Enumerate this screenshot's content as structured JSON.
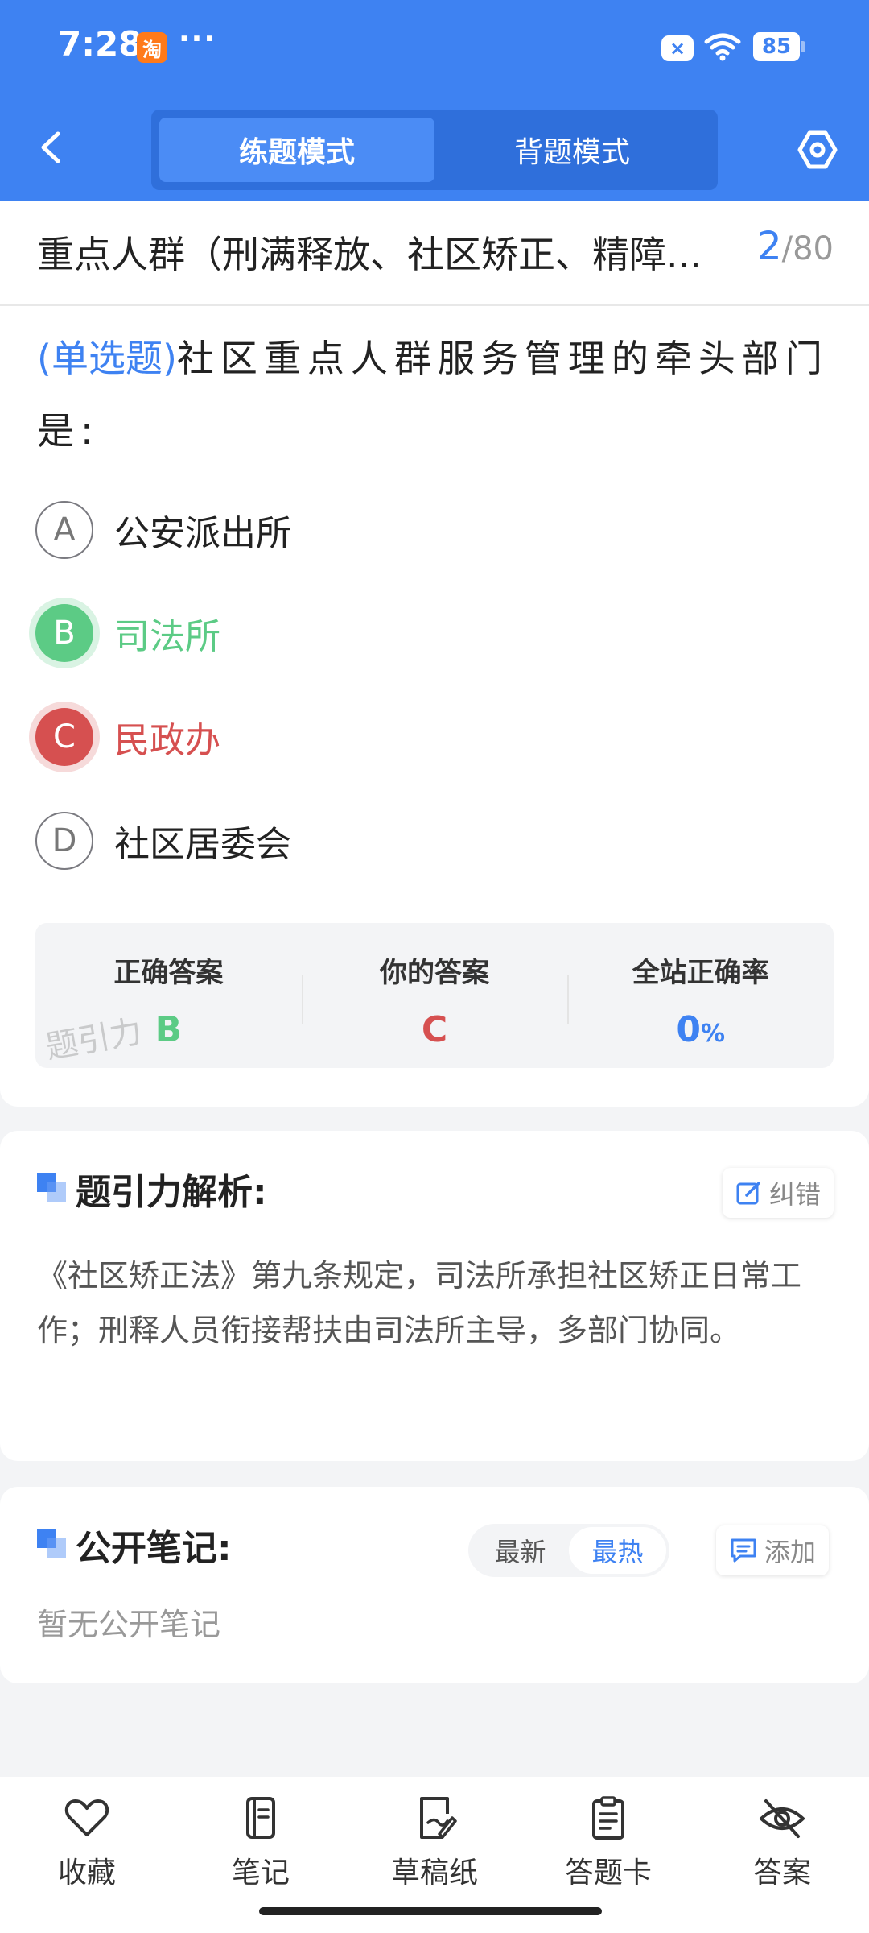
{
  "status_bar": {
    "time": "7:28",
    "app_badge": "淘",
    "dots": "···",
    "x_badge": "×",
    "battery": "85"
  },
  "app_bar": {
    "mode_tabs": [
      {
        "label": "练题模式",
        "active": true
      },
      {
        "label": "背题模式",
        "active": false
      }
    ]
  },
  "question": {
    "title": "重点人群（刑满释放、社区矫正、精障...",
    "current": "2",
    "total": "80",
    "type_tag": "(单选题)",
    "stem": "社区重点人群服务管理的牵头部门是:",
    "options": [
      {
        "letter": "A",
        "text": "公安派出所",
        "state": "normal"
      },
      {
        "letter": "B",
        "text": "司法所",
        "state": "correct"
      },
      {
        "letter": "C",
        "text": "民政办",
        "state": "wrong"
      },
      {
        "letter": "D",
        "text": "社区居委会",
        "state": "normal"
      }
    ]
  },
  "stats": {
    "correct_label": "正确答案",
    "correct_value": "B",
    "yours_label": "你的答案",
    "yours_value": "C",
    "rate_label": "全站正确率",
    "rate_value": "0",
    "rate_unit": "%",
    "watermark": "题引力"
  },
  "analysis": {
    "title": "题引力解析:",
    "report_label": "纠错",
    "text": "《社区矫正法》第九条规定，司法所承担社区矫正日常工作；刑释人员衔接帮扶由司法所主导，多部门协同。"
  },
  "notes": {
    "title": "公开笔记:",
    "sort_options": [
      "最新",
      "最热"
    ],
    "sort_active": "最热",
    "add_label": "添加",
    "empty_text": "暂无公开笔记"
  },
  "bottom_nav": [
    {
      "label": "收藏",
      "icon": "heart-icon"
    },
    {
      "label": "笔记",
      "icon": "notebook-icon"
    },
    {
      "label": "草稿纸",
      "icon": "draft-icon"
    },
    {
      "label": "答题卡",
      "icon": "answer-card-icon"
    },
    {
      "label": "答案",
      "icon": "eye-off-icon"
    }
  ],
  "colors": {
    "primary": "#3e82f2",
    "correct": "#5ccb85",
    "wrong": "#d65050"
  }
}
